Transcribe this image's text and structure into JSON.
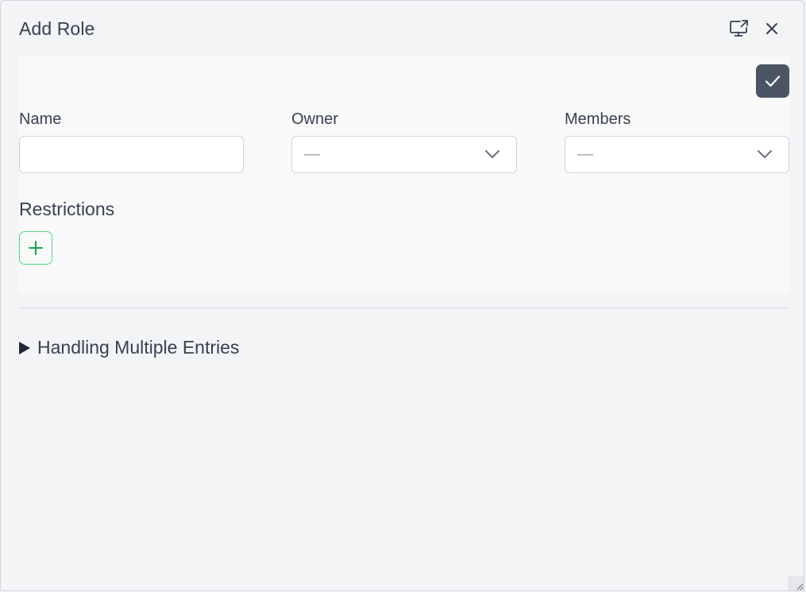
{
  "dialog": {
    "title": "Add Role",
    "popout_icon": "monitor-popout-icon",
    "close_icon": "close-icon"
  },
  "form": {
    "save_icon": "check-icon",
    "name": {
      "label": "Name",
      "value": ""
    },
    "owner": {
      "label": "Owner",
      "value": "—",
      "icon": "chevron-down-icon"
    },
    "members": {
      "label": "Members",
      "value": "—",
      "icon": "chevron-down-icon"
    },
    "restrictions": {
      "label": "Restrictions",
      "add_icon": "plus-icon"
    }
  },
  "section": {
    "title": "Handling Multiple Entries",
    "expanded": false
  },
  "colors": {
    "save_button": "#4b5563",
    "add_button_border": "#4ade80",
    "add_icon": "#16a34a"
  }
}
